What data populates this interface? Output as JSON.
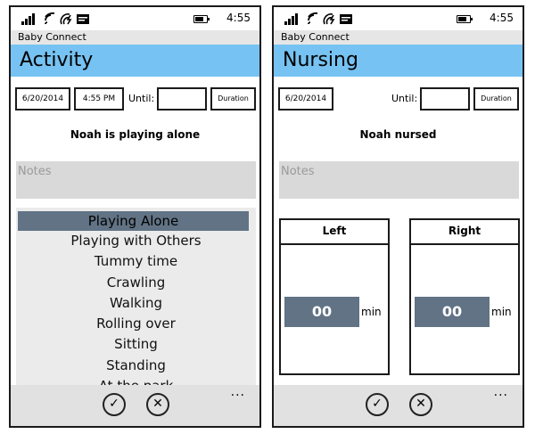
{
  "status": {
    "time": "4:55"
  },
  "activity": {
    "app_name": "Baby Connect",
    "title": "Activity",
    "date": "6/20/2014",
    "time": "4:55 PM",
    "until_label": "Until:",
    "until_value": "",
    "duration_label": "Duration",
    "headline": "Noah is playing alone",
    "notes_placeholder": "Notes",
    "activities": [
      "Playing Alone",
      "Playing with Others",
      "Tummy time",
      "Crawling",
      "Walking",
      "Rolling over",
      "Sitting",
      "Standing",
      "At the park"
    ],
    "selected": "Playing Alone"
  },
  "nursing": {
    "app_name": "Baby Connect",
    "title": "Nursing",
    "date": "6/20/2014",
    "until_label": "Until:",
    "until_value": "",
    "duration_label": "Duration",
    "headline": "Noah nursed",
    "notes_placeholder": "Notes",
    "left": {
      "label": "Left",
      "value": "00",
      "unit": "min"
    },
    "right": {
      "label": "Right",
      "value": "00",
      "unit": "min"
    }
  },
  "appbar": {
    "confirm_icon": "check-icon",
    "cancel_icon": "close-icon",
    "more_icon": "more-icon",
    "more": "..."
  },
  "colors": {
    "title_bar": "#76c2f2",
    "selected": "#617385",
    "notes_bg": "#d9d9d9",
    "list_bg": "#ebebeb"
  }
}
